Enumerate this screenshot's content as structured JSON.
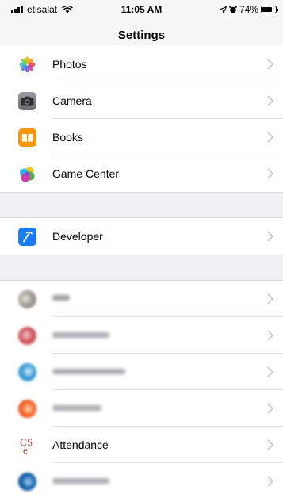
{
  "status_bar": {
    "carrier": "etisalat",
    "time": "11:05 AM",
    "battery": "74%",
    "battery_level": 0.74
  },
  "navbar": {
    "title": "Settings"
  },
  "items": [
    {
      "label": "Photos",
      "icon": "photos-icon"
    },
    {
      "label": "Camera",
      "icon": "camera-icon"
    },
    {
      "label": "Books",
      "icon": "books-icon"
    },
    {
      "label": "Game Center",
      "icon": "game-center-icon"
    },
    {
      "label": "Developer",
      "icon": "developer-icon"
    },
    {
      "label": "Attendance",
      "icon": "cse-icon"
    }
  ],
  "colors": {
    "books": "#ff9500",
    "developer": "#1a7cf5",
    "camera": "#3d3d3d",
    "chevron": "#c7c7cc",
    "group_bg": "#efeff4"
  }
}
